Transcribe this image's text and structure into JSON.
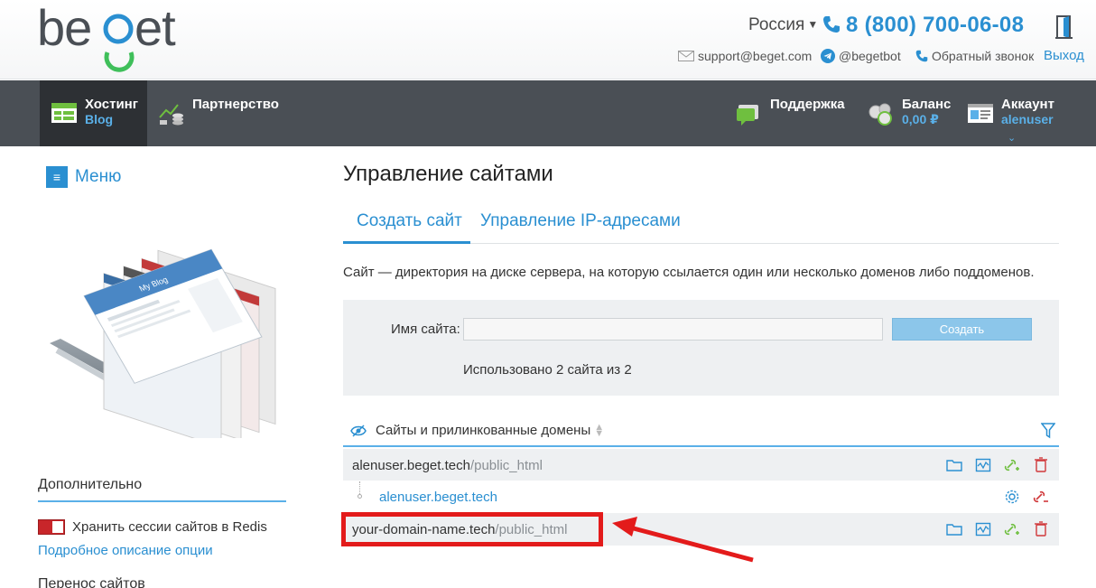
{
  "header": {
    "logo_text": "beget",
    "region": "Россия",
    "phone": "8 (800) 700-06-08",
    "support_email": "support@beget.com",
    "telegram": "@begetbot",
    "callback": "Обратный звонок",
    "exit": "Выход"
  },
  "nav": {
    "hosting": {
      "title": "Хостинг",
      "sub": "Blog"
    },
    "partnership": {
      "title": "Партнерство"
    },
    "support": {
      "title": "Поддержка"
    },
    "balance": {
      "title": "Баланс",
      "sub": "0,00 ₽"
    },
    "account": {
      "title": "Аккаунт",
      "sub": "alenuser"
    }
  },
  "sidebar": {
    "menu_label": "Меню",
    "section_title": "Дополнительно",
    "redis_label": "Хранить сессии сайтов в Redis",
    "redis_enabled": false,
    "details_link": "Подробное описание опции",
    "transfer_title": "Перенос сайтов"
  },
  "main": {
    "title": "Управление сайтами",
    "tabs": [
      {
        "label": "Создать сайт",
        "active": true
      },
      {
        "label": "Управление IP-адресами",
        "active": false
      }
    ],
    "info": "Сайт — директория на диске сервера, на которую ссылается один или несколько доменов либо поддоменов.",
    "create": {
      "name_label": "Имя сайта:",
      "name_value": "",
      "button": "Создать",
      "used": "Использовано 2 сайта из 2"
    },
    "list": {
      "header": "Сайты и прилинкованные домены",
      "rows": [
        {
          "name": "alenuser.beget.tech",
          "path": "/public_html"
        },
        {
          "name": "alenuser.beget.tech"
        },
        {
          "name": "your-domain-name.tech",
          "path": "/public_html"
        }
      ]
    }
  },
  "colors": {
    "accent": "#2a8fd1",
    "nav_bg": "#4a4f55",
    "highlight": "#e31b1b"
  }
}
